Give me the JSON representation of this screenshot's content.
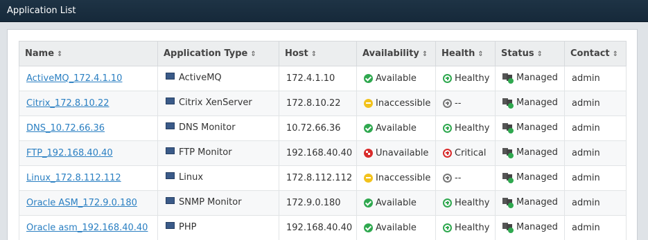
{
  "window": {
    "title": "Application List"
  },
  "table": {
    "columns": [
      "Name",
      "Application Type",
      "Host",
      "Availability",
      "Health",
      "Status",
      "Contact"
    ],
    "sort_glyph": "⇕",
    "rows": [
      {
        "name": "ActiveMQ_172.4.1.10",
        "type": "ActiveMQ",
        "type_icon": "activemq-icon",
        "host": "172.4.1.10",
        "availability": "Available",
        "availability_color": "#2fa84f",
        "health": "Healthy",
        "health_color": "#2fa84f",
        "status": "Managed",
        "contact": "admin"
      },
      {
        "name": "Citrix_172.8.10.22",
        "type": "Citrix XenServer",
        "type_icon": "citrix-xen-icon",
        "host": "172.8.10.22",
        "availability": "Inaccessible",
        "availability_color": "#f2c21c",
        "health": "--",
        "health_color": "#777777",
        "status": "Managed",
        "contact": "admin"
      },
      {
        "name": "DNS_10.72.66.36",
        "type": "DNS Monitor",
        "type_icon": "dns-icon",
        "host": "10.72.66.36",
        "availability": "Available",
        "availability_color": "#2fa84f",
        "health": "Healthy",
        "health_color": "#2fa84f",
        "status": "Managed",
        "contact": "admin"
      },
      {
        "name": "FTP_192.168.40.40",
        "type": "FTP Monitor",
        "type_icon": "ftp-icon",
        "host": "192.168.40.40",
        "availability": "Unavailable",
        "availability_color": "#d92b2b",
        "health": "Critical",
        "health_color": "#d92b2b",
        "status": "Managed",
        "contact": "admin"
      },
      {
        "name": "Linux_172.8.112.112",
        "type": "Linux",
        "type_icon": "linux-icon",
        "host": "172.8.112.112",
        "availability": "Inaccessible",
        "availability_color": "#f2c21c",
        "health": "--",
        "health_color": "#777777",
        "status": "Managed",
        "contact": "admin"
      },
      {
        "name": "Oracle ASM_172.9.0.180",
        "type": "SNMP Monitor",
        "type_icon": "snmp-icon",
        "host": "172.9.0.180",
        "availability": "Available",
        "availability_color": "#2fa84f",
        "health": "Healthy",
        "health_color": "#2fa84f",
        "status": "Managed",
        "contact": "admin"
      },
      {
        "name": "Oracle asm_192.168.40.40",
        "type": "PHP",
        "type_icon": "php-icon",
        "host": "192.168.40.40",
        "availability": "Available",
        "availability_color": "#2fa84f",
        "health": "Healthy",
        "health_color": "#2fa84f",
        "status": "Managed",
        "contact": "admin"
      }
    ]
  }
}
